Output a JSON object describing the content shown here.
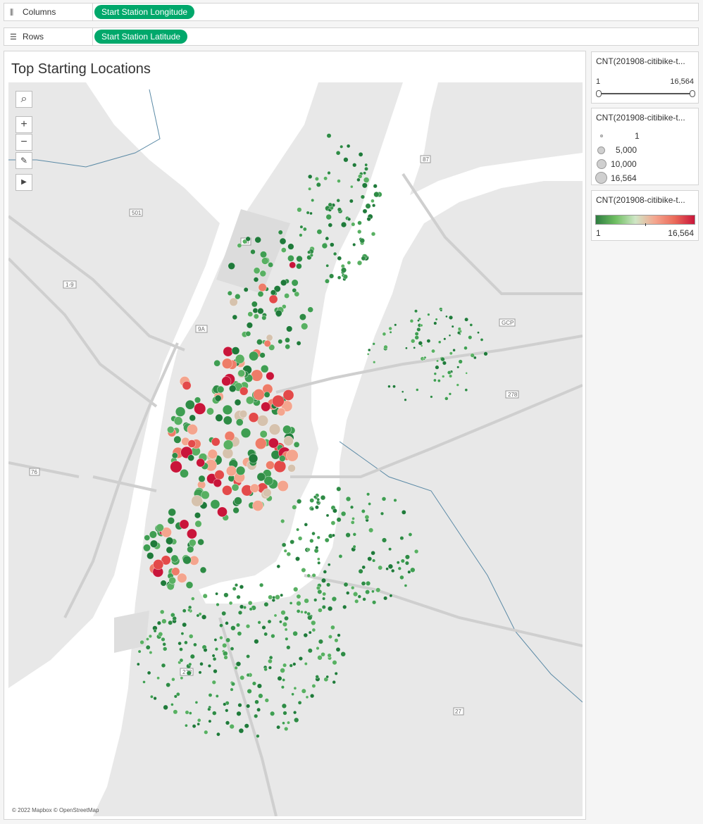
{
  "shelves": {
    "columns": {
      "label": "Columns",
      "pill": "Start Station Longitude"
    },
    "rows": {
      "label": "Rows",
      "pill": "Start Station Latitude"
    }
  },
  "sheet": {
    "title": "Top Starting Locations"
  },
  "map": {
    "credit": "© 2022 Mapbox © OpenStreetMap",
    "road_labels": [
      "87",
      "501",
      "HI",
      "1-9",
      "9A",
      "GCP",
      "278",
      "76",
      "278",
      "27"
    ],
    "tools": [
      "search-icon",
      "zoom-in-icon",
      "zoom-out-icon",
      "pin-map-icon",
      "expand-toolbar-icon"
    ]
  },
  "filter_card": {
    "title": "CNT(201908-citibike-t...",
    "min": "1",
    "max": "16,564"
  },
  "size_legend": {
    "title": "CNT(201908-citibike-t...",
    "items": [
      {
        "label": "1",
        "value": 1
      },
      {
        "label": "5,000",
        "value": 5000
      },
      {
        "label": "10,000",
        "value": 10000
      },
      {
        "label": "16,564",
        "value": 16564
      }
    ]
  },
  "color_legend": {
    "title": "CNT(201908-citibike-t...",
    "min": "1",
    "max": "16,564",
    "colors": [
      "#2e7d40",
      "#6fbf62",
      "#cfe6c6",
      "#f4a58e",
      "#ea6a5a",
      "#c9153a"
    ]
  }
}
